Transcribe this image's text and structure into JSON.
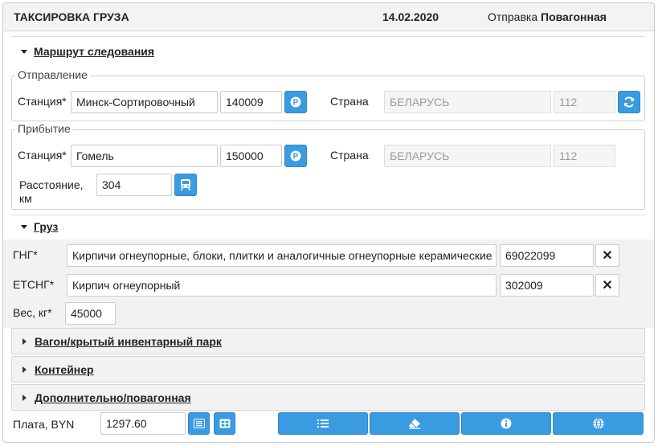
{
  "header": {
    "title": "ТАКСИРОВКА ГРУЗА",
    "date": "14.02.2020",
    "shipment_label": "Отправка",
    "shipment_value": "Повагонная"
  },
  "route": {
    "section_title": "Маршрут следования",
    "departure": {
      "legend": "Отправление",
      "station_label": "Станция*",
      "station_name": "Минск-Сортировочный",
      "station_code": "140009",
      "country_label": "Страна",
      "country_name": "БЕЛАРУСЬ",
      "country_code": "112"
    },
    "arrival": {
      "legend": "Прибытие",
      "station_label": "Станция*",
      "station_name": "Гомель",
      "station_code": "150000",
      "country_label": "Страна",
      "country_name": "БЕЛАРУСЬ",
      "country_code": "112",
      "distance_label_line1": "Расстояние,",
      "distance_label_line2": "км",
      "distance_value": "304"
    }
  },
  "cargo": {
    "section_title": "Груз",
    "gng_label": "ГНГ*",
    "gng_name": "Кирпичи огнеупорные, блоки, плитки и аналогичные огнеупорные керамические",
    "gng_code": "69022099",
    "etsng_label": "ЕТСНГ*",
    "etsng_name": "Кирпич огнеупорный",
    "etsng_code": "302009",
    "weight_label": "Вес, кг*",
    "weight_value": "45000",
    "clear_symbol": "✕"
  },
  "panels": [
    {
      "title": "Вагон/крытый инвентарный парк"
    },
    {
      "title": "Контейнер"
    },
    {
      "title": "Дополнительно/повагонная"
    }
  ],
  "footer": {
    "fee_label": "Плата, BYN",
    "fee_value": "1297.60"
  },
  "colors": {
    "accent": "#3a9be0",
    "header_bg": "#f3f3f3",
    "panel_bg": "#f2f2f2"
  },
  "icons": [
    "refresh-icon",
    "parking-icon",
    "train-icon",
    "close-icon",
    "list-icon",
    "table-icon",
    "eraser-icon",
    "info-icon",
    "globe-icon"
  ]
}
